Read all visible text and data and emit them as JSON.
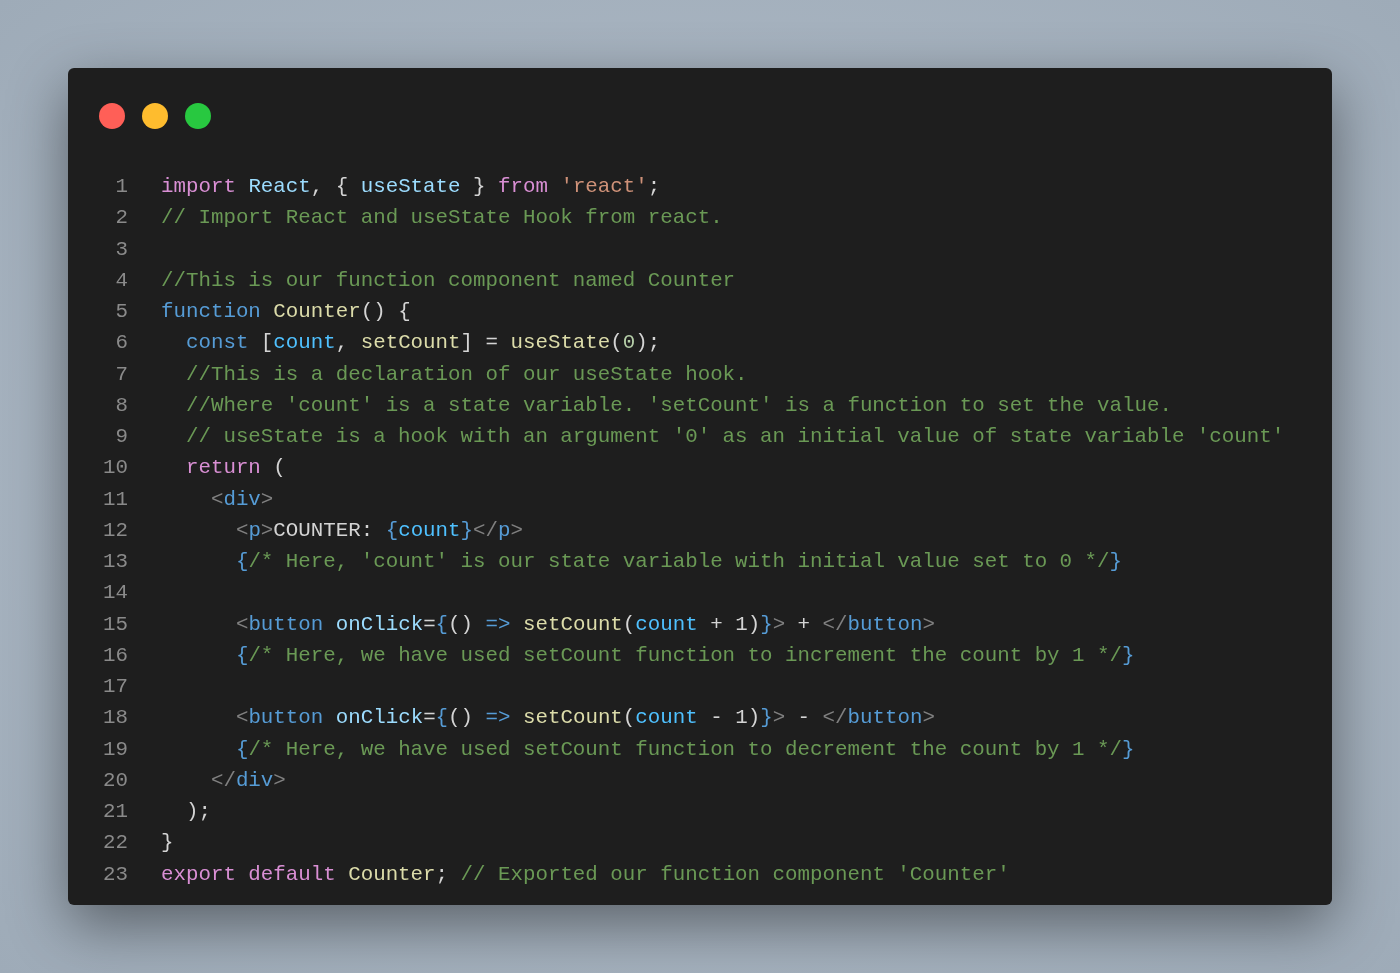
{
  "window_buttons": [
    {
      "color": "#ff5f57"
    },
    {
      "color": "#febc2e"
    },
    {
      "color": "#28c840"
    }
  ],
  "code_lines": [
    {
      "number": "1",
      "tokens": [
        {
          "text": "import ",
          "color": "#d98fd4"
        },
        {
          "text": "React",
          "color": "#9cdcfe"
        },
        {
          "text": ", { ",
          "color": "#d4d4d4"
        },
        {
          "text": "useState",
          "color": "#9cdcfe"
        },
        {
          "text": " } ",
          "color": "#d4d4d4"
        },
        {
          "text": "from ",
          "color": "#d98fd4"
        },
        {
          "text": "'react'",
          "color": "#ce9178"
        },
        {
          "text": ";",
          "color": "#d4d4d4"
        }
      ]
    },
    {
      "number": "2",
      "tokens": [
        {
          "text": "// Import React and useState Hook from react.",
          "color": "#6a9955"
        }
      ]
    },
    {
      "number": "3"
    },
    {
      "number": "4",
      "tokens": [
        {
          "text": "//This is our function component named Counter",
          "color": "#6a9955"
        }
      ]
    },
    {
      "number": "5",
      "tokens": [
        {
          "text": "function ",
          "color": "#569cd6"
        },
        {
          "text": "Counter",
          "color": "#dcdcaa"
        },
        {
          "text": "() {",
          "color": "#d4d4d4"
        }
      ]
    },
    {
      "number": "6",
      "tokens": [
        {
          "text": "  const ",
          "color": "#569cd6"
        },
        {
          "text": "[",
          "color": "#d4d4d4"
        },
        {
          "text": "count",
          "color": "#4fc1ff"
        },
        {
          "text": ", ",
          "color": "#d4d4d4"
        },
        {
          "text": "setCount",
          "color": "#dcdcaa"
        },
        {
          "text": "] = ",
          "color": "#d4d4d4"
        },
        {
          "text": "useState",
          "color": "#dcdcaa"
        },
        {
          "text": "(",
          "color": "#d4d4d4"
        },
        {
          "text": "0",
          "color": "#b5cea8"
        },
        {
          "text": ");",
          "color": "#d4d4d4"
        }
      ]
    },
    {
      "number": "7",
      "tokens": [
        {
          "text": "  //This is a declaration of our useState hook.",
          "color": "#6a9955"
        }
      ]
    },
    {
      "number": "8",
      "tokens": [
        {
          "text": "  //Where 'count' is a state variable. 'setCount' is a function to set the value.",
          "color": "#6a9955"
        }
      ]
    },
    {
      "number": "9",
      "tokens": [
        {
          "text": "  // useState is a hook with an argument '0' as an initial value of state variable 'count'",
          "color": "#6a9955"
        }
      ]
    },
    {
      "number": "10",
      "tokens": [
        {
          "text": "  return ",
          "color": "#d98fd4"
        },
        {
          "text": "(",
          "color": "#d4d4d4"
        }
      ]
    },
    {
      "number": "11",
      "tokens": [
        {
          "text": "    <",
          "color": "#808080"
        },
        {
          "text": "div",
          "color": "#569cd6"
        },
        {
          "text": ">",
          "color": "#808080"
        }
      ]
    },
    {
      "number": "12",
      "tokens": [
        {
          "text": "      <",
          "color": "#808080"
        },
        {
          "text": "p",
          "color": "#569cd6"
        },
        {
          "text": ">",
          "color": "#808080"
        },
        {
          "text": "COUNTER: ",
          "color": "#d4d4d4"
        },
        {
          "text": "{",
          "color": "#569cd6"
        },
        {
          "text": "count",
          "color": "#4fc1ff"
        },
        {
          "text": "}",
          "color": "#569cd6"
        },
        {
          "text": "</",
          "color": "#808080"
        },
        {
          "text": "p",
          "color": "#569cd6"
        },
        {
          "text": ">",
          "color": "#808080"
        }
      ]
    },
    {
      "number": "13",
      "tokens": [
        {
          "text": "      {",
          "color": "#569cd6"
        },
        {
          "text": "/* Here, 'count' is our state variable with initial value set to 0 */",
          "color": "#6a9955"
        },
        {
          "text": "}",
          "color": "#569cd6"
        }
      ]
    },
    {
      "number": "14"
    },
    {
      "number": "15",
      "tokens": [
        {
          "text": "      <",
          "color": "#808080"
        },
        {
          "text": "button ",
          "color": "#569cd6"
        },
        {
          "text": "onClick",
          "color": "#9cdcfe"
        },
        {
          "text": "=",
          "color": "#d4d4d4"
        },
        {
          "text": "{",
          "color": "#569cd6"
        },
        {
          "text": "() ",
          "color": "#d4d4d4"
        },
        {
          "text": "=> ",
          "color": "#569cd6"
        },
        {
          "text": "setCount",
          "color": "#dcdcaa"
        },
        {
          "text": "(",
          "color": "#d4d4d4"
        },
        {
          "text": "count",
          "color": "#4fc1ff"
        },
        {
          "text": " + 1)",
          "color": "#d4d4d4"
        },
        {
          "text": "}",
          "color": "#569cd6"
        },
        {
          "text": ">",
          "color": "#808080"
        },
        {
          "text": " + ",
          "color": "#d4d4d4"
        },
        {
          "text": "</",
          "color": "#808080"
        },
        {
          "text": "button",
          "color": "#569cd6"
        },
        {
          "text": ">",
          "color": "#808080"
        }
      ]
    },
    {
      "number": "16",
      "tokens": [
        {
          "text": "      {",
          "color": "#569cd6"
        },
        {
          "text": "/* Here, we have used setCount function to increment the count by 1 */",
          "color": "#6a9955"
        },
        {
          "text": "}",
          "color": "#569cd6"
        }
      ]
    },
    {
      "number": "17"
    },
    {
      "number": "18",
      "tokens": [
        {
          "text": "      <",
          "color": "#808080"
        },
        {
          "text": "button ",
          "color": "#569cd6"
        },
        {
          "text": "onClick",
          "color": "#9cdcfe"
        },
        {
          "text": "=",
          "color": "#d4d4d4"
        },
        {
          "text": "{",
          "color": "#569cd6"
        },
        {
          "text": "() ",
          "color": "#d4d4d4"
        },
        {
          "text": "=> ",
          "color": "#569cd6"
        },
        {
          "text": "setCount",
          "color": "#dcdcaa"
        },
        {
          "text": "(",
          "color": "#d4d4d4"
        },
        {
          "text": "count",
          "color": "#4fc1ff"
        },
        {
          "text": " - 1)",
          "color": "#d4d4d4"
        },
        {
          "text": "}",
          "color": "#569cd6"
        },
        {
          "text": ">",
          "color": "#808080"
        },
        {
          "text": " - ",
          "color": "#d4d4d4"
        },
        {
          "text": "</",
          "color": "#808080"
        },
        {
          "text": "button",
          "color": "#569cd6"
        },
        {
          "text": ">",
          "color": "#808080"
        }
      ]
    },
    {
      "number": "19",
      "tokens": [
        {
          "text": "      {",
          "color": "#569cd6"
        },
        {
          "text": "/* Here, we have used setCount function to decrement the count by 1 */",
          "color": "#6a9955"
        },
        {
          "text": "}",
          "color": "#569cd6"
        }
      ]
    },
    {
      "number": "20",
      "tokens": [
        {
          "text": "    </",
          "color": "#808080"
        },
        {
          "text": "div",
          "color": "#569cd6"
        },
        {
          "text": ">",
          "color": "#808080"
        }
      ]
    },
    {
      "number": "21",
      "tokens": [
        {
          "text": "  );",
          "color": "#d4d4d4"
        }
      ]
    },
    {
      "number": "22",
      "tokens": [
        {
          "text": "}",
          "color": "#d4d4d4"
        }
      ]
    },
    {
      "number": "23",
      "tokens": [
        {
          "text": "export default ",
          "color": "#d98fd4"
        },
        {
          "text": "Counter",
          "color": "#dcdcaa"
        },
        {
          "text": "; ",
          "color": "#d4d4d4"
        },
        {
          "text": "// Exported our function component 'Counter'",
          "color": "#6a9955"
        }
      ]
    }
  ]
}
